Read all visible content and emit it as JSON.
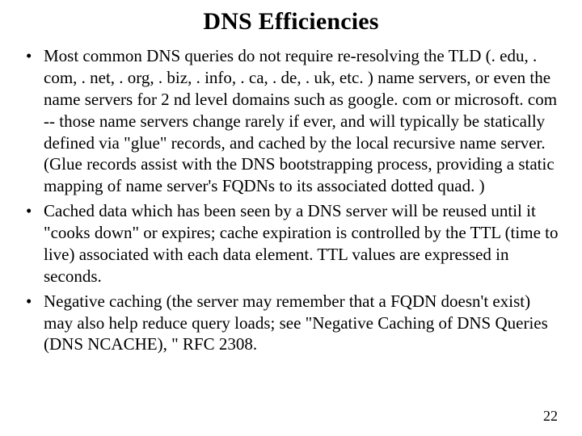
{
  "title": "DNS Efficiencies",
  "bullets": [
    "Most common DNS queries do not require re-resolving the TLD (. edu, . com, . net, . org, . biz, . info, . ca, . de, . uk, etc. ) name servers, or even the name servers for 2 nd level domains such as google. com or microsoft. com -- those name servers change rarely if ever, and will typically be statically defined via \"glue\" records, and cached by the local recursive name server. (Glue records assist with the DNS bootstrapping process, providing a static mapping of name server's FQDNs to its associated dotted quad. )",
    "Cached data which has been seen by a DNS server will be reused until it \"cooks down\" or expires; cache expiration is controlled by the TTL (time to live) associated with each data element. TTL values are expressed in seconds.",
    "Negative caching (the server may remember that a FQDN doesn't exist) may also help reduce query loads; see \"Negative Caching of DNS Queries (DNS NCACHE), \" RFC 2308."
  ],
  "page_number": "22"
}
